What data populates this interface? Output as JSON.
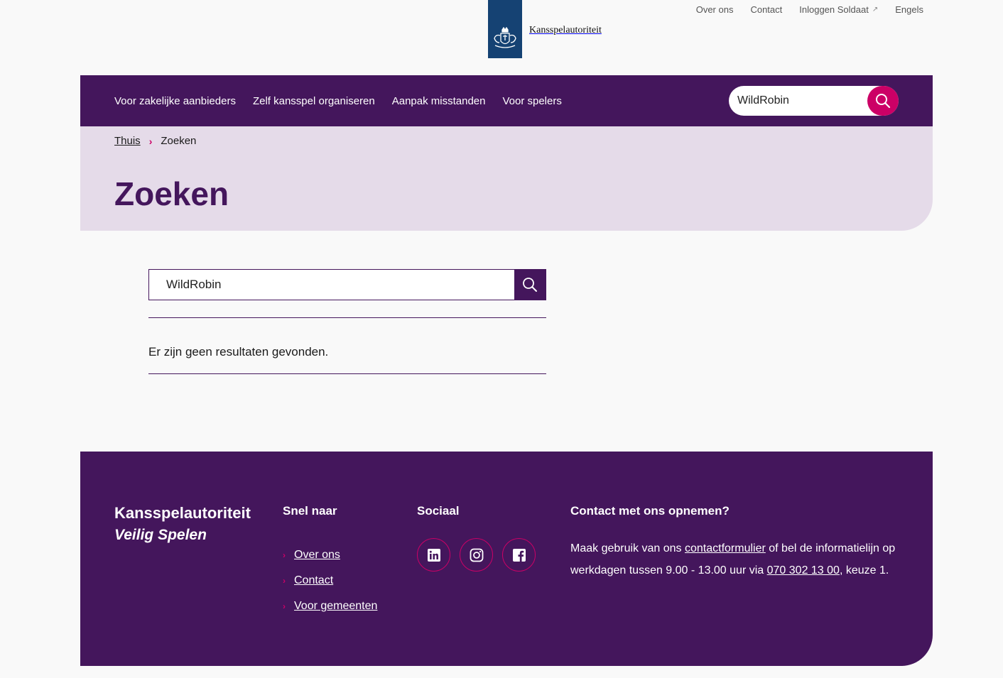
{
  "utility_nav": {
    "items": [
      "Over ons",
      "Contact",
      "Inloggen Soldaat",
      "Engels"
    ]
  },
  "logo": {
    "text": "Kansspelautoriteit"
  },
  "main_nav": {
    "items": [
      "Voor zakelijke aanbieders",
      "Zelf kansspel organiseren",
      "Aanpak misstanden",
      "Voor spelers"
    ],
    "search_value": "WildRobin"
  },
  "breadcrumb": {
    "home": "Thuis",
    "current": "Zoeken"
  },
  "page": {
    "title": "Zoeken"
  },
  "search": {
    "value": "WildRobin",
    "no_results": "Er zijn geen resultaten gevonden."
  },
  "footer": {
    "brand_name": "Kansspelautoriteit",
    "brand_tagline": "Veilig Spelen",
    "quick_heading": "Snel naar",
    "quick_links": [
      "Over ons",
      "Contact",
      "Voor gemeenten"
    ],
    "social_heading": "Sociaal",
    "social_icons": [
      "linkedin-icon",
      "instagram-icon",
      "facebook-icon"
    ],
    "contact_heading": "Contact met ons opnemen?",
    "contact_pre": "Maak gebruik van ons ",
    "contact_link": "contactformulier",
    "contact_mid": " of bel de informatielijn op werkdagen tussen 9.00 - 13.00 uur via ",
    "contact_phone": "070 302 13 00",
    "contact_post": ", keuze 1."
  },
  "colors": {
    "primary": "#44165c",
    "accent": "#cc0066",
    "hero_bg": "#e5dbe9",
    "logo_blue": "#154273"
  }
}
